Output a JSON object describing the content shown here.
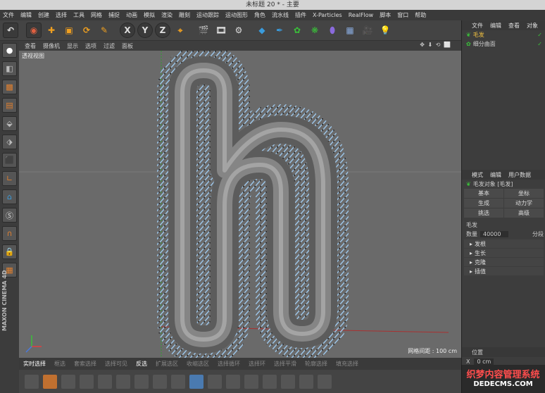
{
  "window": {
    "title": "未标题 20 * - 主要"
  },
  "menubar": {
    "items": [
      "文件",
      "编辑",
      "创建",
      "选择",
      "工具",
      "网格",
      "捕捉",
      "动画",
      "模拟",
      "渲染",
      "雕刻",
      "运动跟踪",
      "运动图形",
      "角色",
      "流水线",
      "插件",
      "X-Particles",
      "RealFlow",
      "脚本",
      "窗口",
      "帮助"
    ]
  },
  "toolbar": {
    "axis_x": "X",
    "axis_y": "Y",
    "axis_z": "Z"
  },
  "viewport": {
    "menu": [
      "查看",
      "摄像机",
      "显示",
      "选项",
      "过滤",
      "面板"
    ],
    "label": "透视视图",
    "grid_spacing": "网格间距 : 100 cm",
    "nav_glyphs": "✥ ⬇ ⟲ ⬜"
  },
  "bottombar": {
    "items": [
      "实时选择",
      "框选",
      "套索选择",
      "选择可见",
      "反选",
      "扩展选区",
      "收缩选区",
      "选择循环",
      "选择环",
      "选择平滑",
      "轮廓选择",
      "填充选择"
    ]
  },
  "brand": {
    "line1": "MAXON",
    "line2": "CINEMA 4D"
  },
  "object_manager": {
    "tabs": [
      "文件",
      "编辑",
      "查看",
      "对象"
    ],
    "objects": [
      "毛发",
      "细分曲面"
    ]
  },
  "attribute_manager": {
    "tabs": [
      "模式",
      "编辑",
      "用户数据"
    ],
    "object_title": "毛发对象 [毛发]",
    "buttons": [
      "基本",
      "坐标",
      "生成",
      "动力学",
      "挑选",
      "高级"
    ],
    "section": "毛发",
    "count_label": "数量",
    "count_value": "40000",
    "segments_label": "分段",
    "groups": [
      "发根",
      "生长",
      "克隆",
      "插值"
    ]
  },
  "coordinates": {
    "title": "位置",
    "x_value": "0 cm"
  },
  "watermark": {
    "line1": "织梦内容管理系统",
    "line2": "DEDECMS.COM"
  },
  "colors": {
    "fur": "#8fb8e0",
    "viewport_bg": "#6a6a6a",
    "panel": "#3d3d3d"
  }
}
